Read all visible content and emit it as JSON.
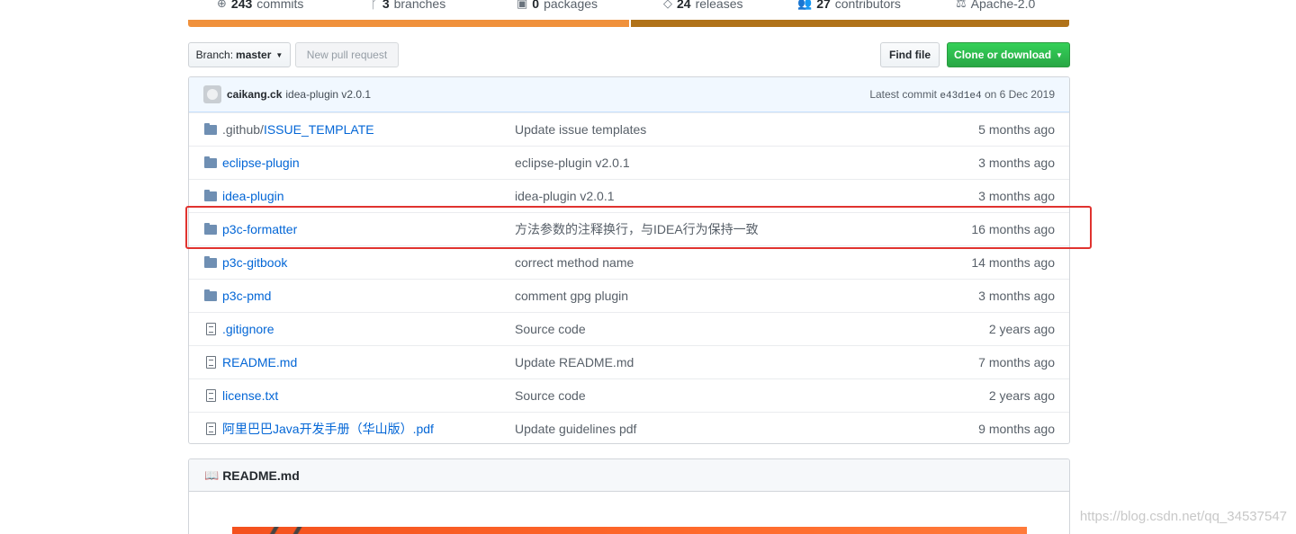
{
  "stats": [
    {
      "icon": "commits-icon",
      "count": "243",
      "label": "commits"
    },
    {
      "icon": "branch-icon",
      "count": "3",
      "label": "branches"
    },
    {
      "icon": "package-icon",
      "count": "0",
      "label": "packages"
    },
    {
      "icon": "tag-icon",
      "count": "24",
      "label": "releases"
    },
    {
      "icon": "people-icon",
      "count": "27",
      "label": "contributors"
    },
    {
      "icon": "law-icon",
      "count": "",
      "label": "Apache-2.0"
    }
  ],
  "colors": {
    "java": "#f0913c",
    "other": "#b07219",
    "clone": "#28a745",
    "highlight": "#e0332f",
    "link": "#0366d6"
  },
  "toolbar": {
    "branch_prefix": "Branch:",
    "branch_name": "master",
    "new_pr": "New pull request",
    "find_file": "Find file",
    "clone": "Clone or download"
  },
  "commit": {
    "author": "caikang.ck",
    "message": "idea-plugin v2.0.1",
    "latest_prefix": "Latest commit",
    "sha": "e43d1e4",
    "date": "on 6 Dec 2019"
  },
  "files": [
    {
      "type": "dir",
      "name_prefix": ".github/",
      "name": "ISSUE_TEMPLATE",
      "message": "Update issue templates",
      "age": "5 months ago"
    },
    {
      "type": "dir",
      "name_prefix": "",
      "name": "eclipse-plugin",
      "message": "eclipse-plugin v2.0.1",
      "age": "3 months ago"
    },
    {
      "type": "dir",
      "name_prefix": "",
      "name": "idea-plugin",
      "message": "idea-plugin v2.0.1",
      "age": "3 months ago"
    },
    {
      "type": "dir",
      "name_prefix": "",
      "name": "p3c-formatter",
      "message": "方法参数的注释换行，与IDEA行为保持一致",
      "age": "16 months ago"
    },
    {
      "type": "dir",
      "name_prefix": "",
      "name": "p3c-gitbook",
      "message": "correct method name",
      "age": "14 months ago"
    },
    {
      "type": "dir",
      "name_prefix": "",
      "name": "p3c-pmd",
      "message": "comment gpg plugin",
      "age": "3 months ago"
    },
    {
      "type": "file",
      "name_prefix": "",
      "name": ".gitignore",
      "message": "Source code",
      "age": "2 years ago"
    },
    {
      "type": "file",
      "name_prefix": "",
      "name": "README.md",
      "message": "Update README.md",
      "age": "7 months ago"
    },
    {
      "type": "file",
      "name_prefix": "",
      "name": "license.txt",
      "message": "Source code",
      "age": "2 years ago"
    },
    {
      "type": "file",
      "name_prefix": "",
      "name": "阿里巴巴Java开发手册（华山版）.pdf",
      "message": "Update guidelines pdf",
      "age": "9 months ago"
    }
  ],
  "readme": {
    "title": "README.md"
  },
  "watermark": "https://blog.csdn.net/qq_34537547"
}
